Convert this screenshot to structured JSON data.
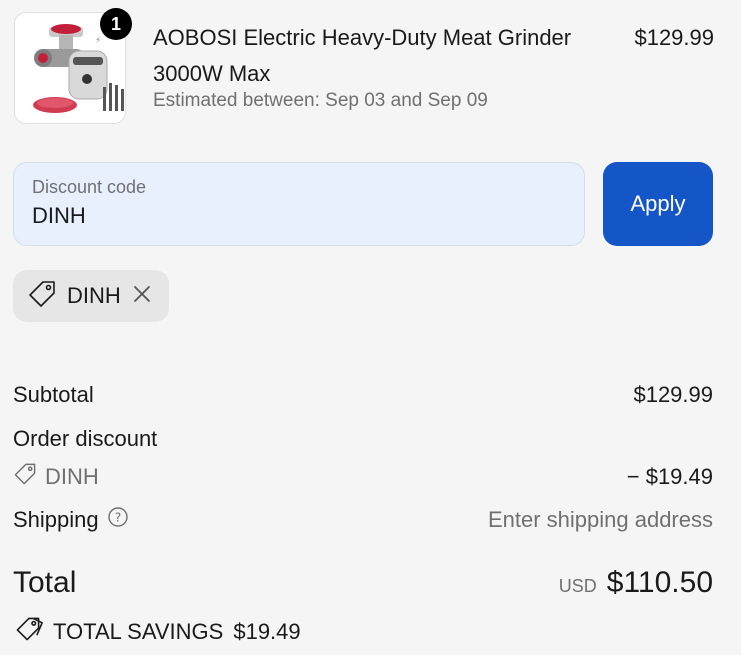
{
  "product": {
    "quantity": "1",
    "name": "AOBOSI Electric Heavy-Duty Meat Grinder 3000W Max",
    "eta": "Estimated between: Sep 03 and Sep 09",
    "price": "$129.99"
  },
  "discount": {
    "label": "Discount code",
    "value": "DINH",
    "apply_label": "Apply",
    "applied_code": "DINH"
  },
  "summary": {
    "subtotal_label": "Subtotal",
    "subtotal_value": "$129.99",
    "order_discount_label": "Order discount",
    "discount_code": "DINH",
    "discount_value": "− $19.49",
    "shipping_label": "Shipping",
    "shipping_value": "Enter shipping address",
    "total_label": "Total",
    "currency": "USD",
    "total_value": "$110.50",
    "savings_label": "TOTAL SAVINGS",
    "savings_value": "$19.49"
  },
  "colors": {
    "accent": "#1456c7",
    "field_bg": "#e8f0fe",
    "muted": "#707070"
  },
  "icons": [
    "tag-icon",
    "close-icon",
    "info-icon",
    "tags-icon"
  ]
}
